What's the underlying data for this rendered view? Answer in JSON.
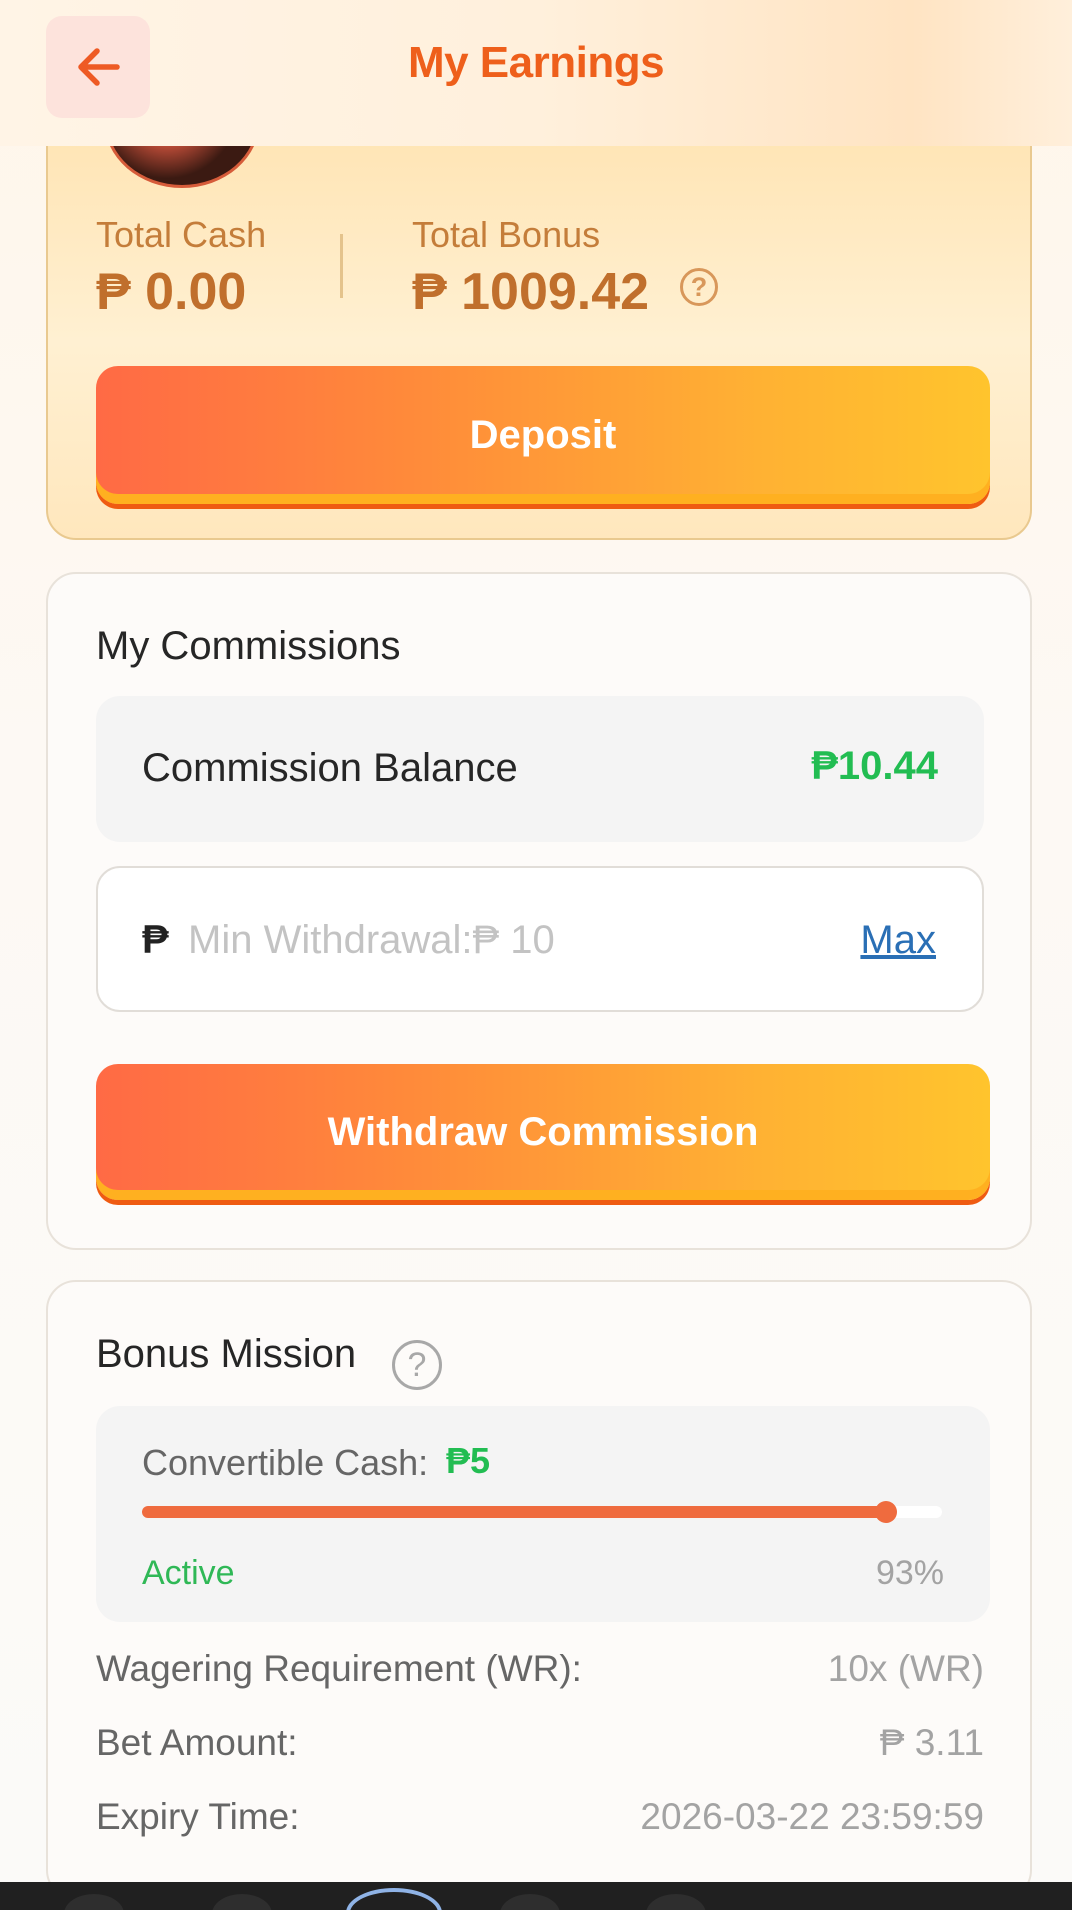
{
  "header": {
    "title": "My Earnings",
    "back_icon": "arrow-left-icon"
  },
  "wallet": {
    "total_cash_label": "Total Cash",
    "total_cash_value": "₱ 0.00",
    "total_bonus_label": "Total Bonus",
    "total_bonus_value": "₱ 1009.42",
    "help_symbol": "?",
    "deposit_label": "Deposit"
  },
  "commissions": {
    "title": "My Commissions",
    "balance_label": "Commission Balance",
    "balance_value": "₱10.44",
    "currency_symbol": "₱",
    "withdraw_placeholder": "Min Withdrawal:₱ 10",
    "max_label": "Max",
    "withdraw_button_label": "Withdraw Commission"
  },
  "bonus_mission": {
    "title": "Bonus Mission",
    "help_symbol": "?",
    "convertible_label": "Convertible Cash:",
    "convertible_value": "₱5",
    "status": "Active",
    "progress_percent": 93,
    "progress_label": "93%",
    "details": [
      {
        "label": "Wagering Requirement (WR):",
        "value": "10x (WR)"
      },
      {
        "label": "Bet Amount:",
        "value": "₱ 3.11"
      },
      {
        "label": "Expiry Time:",
        "value": "2026-03-22 23:59:59"
      }
    ]
  },
  "colors": {
    "accent": "#ee5f1b",
    "positive": "#22bd52",
    "progress": "#ef6b3e",
    "link": "#2a6fb5"
  }
}
